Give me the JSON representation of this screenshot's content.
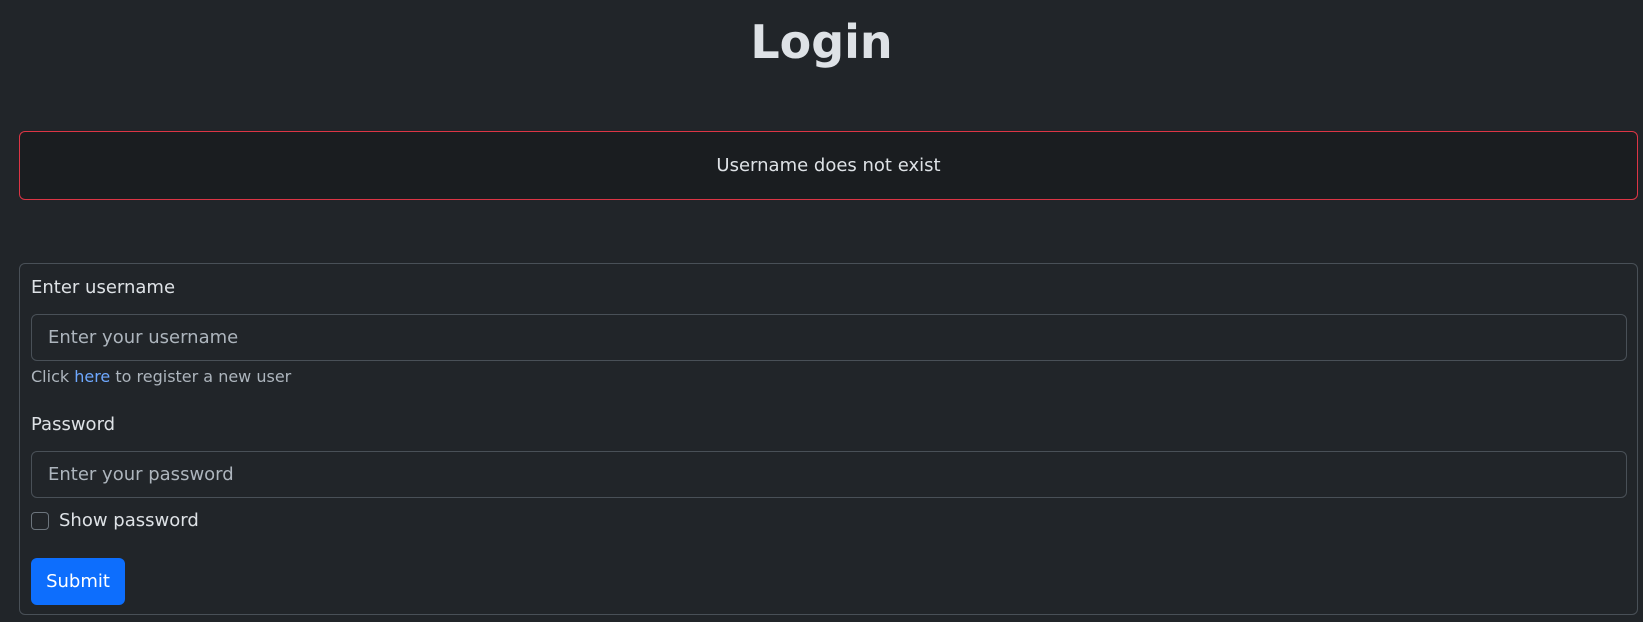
{
  "page": {
    "title": "Login"
  },
  "alert": {
    "message": "Username does not exist",
    "border_color": "#dc3545"
  },
  "form": {
    "username_label": "Enter username",
    "username_placeholder": "Enter your username",
    "username_value": "",
    "register_prefix": "Click ",
    "register_link": "here",
    "register_suffix": " to register a new user",
    "password_label": "Password",
    "password_placeholder": "Enter your password",
    "password_value": "",
    "show_password_label": "Show password",
    "show_password_checked": false,
    "submit_label": "Submit",
    "accent_color": "#0d6efd"
  }
}
